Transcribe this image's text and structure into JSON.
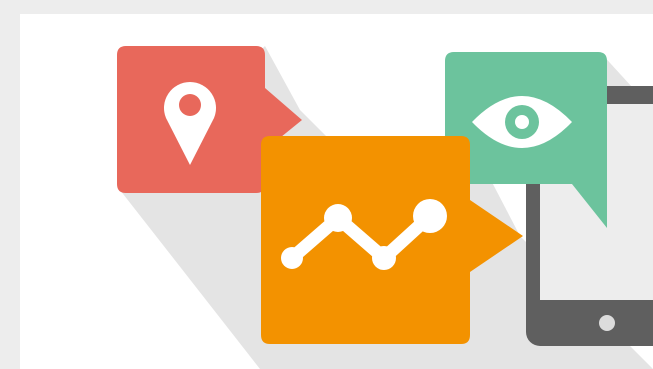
{
  "illustration": {
    "icons": [
      {
        "name": "location-pin-icon",
        "color": "#e8685b"
      },
      {
        "name": "analytics-line-chart-icon",
        "color": "#f39200"
      },
      {
        "name": "eye-icon",
        "color": "#6cc39d"
      },
      {
        "name": "tablet-device-icon",
        "color": "#5f5f5f"
      }
    ],
    "colors": {
      "background": "#ffffff",
      "page_edge": "#ededed",
      "shadow": "#e2e2e2",
      "pin": "#e8685b",
      "analytics": "#f39200",
      "eye": "#6cc39d",
      "tablet": "#5f5f5f",
      "glyph": "#ffffff"
    }
  }
}
